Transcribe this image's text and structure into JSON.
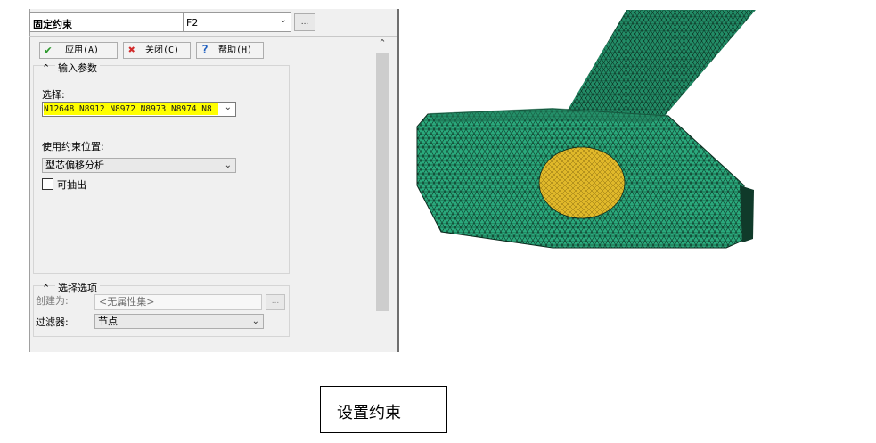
{
  "dialog": {
    "name_value": "固定约束",
    "type_value": "F2",
    "ellipsis": "..."
  },
  "toolbar": {
    "apply_label": "应用(A)",
    "close_label": "关闭(C)",
    "help_label": "帮助(H)"
  },
  "input_params": {
    "header": "输入参数",
    "select_label": "选择:",
    "select_value": "N12648 N8912 N8972 N8973 N8974 N8",
    "location_label": "使用约束位置:",
    "location_value": "型芯偏移分析",
    "checkbox_label": "可抽出",
    "checkbox_checked": false
  },
  "selection_options": {
    "header": "选择选项",
    "create_as_label": "创建为:",
    "create_as_value": "<无属性集>",
    "filter_label": "过滤器:",
    "filter_value": "节点",
    "ellipsis": "..."
  },
  "caption": "设置约束",
  "colors": {
    "mesh_fill": "#2aa97c",
    "mesh_line": "#0b2b1e",
    "constraint_face": "#e0b82a",
    "select_highlight": "#ffff00"
  },
  "icons": {
    "apply": "check-icon",
    "close": "x-icon",
    "help": "question-icon"
  }
}
